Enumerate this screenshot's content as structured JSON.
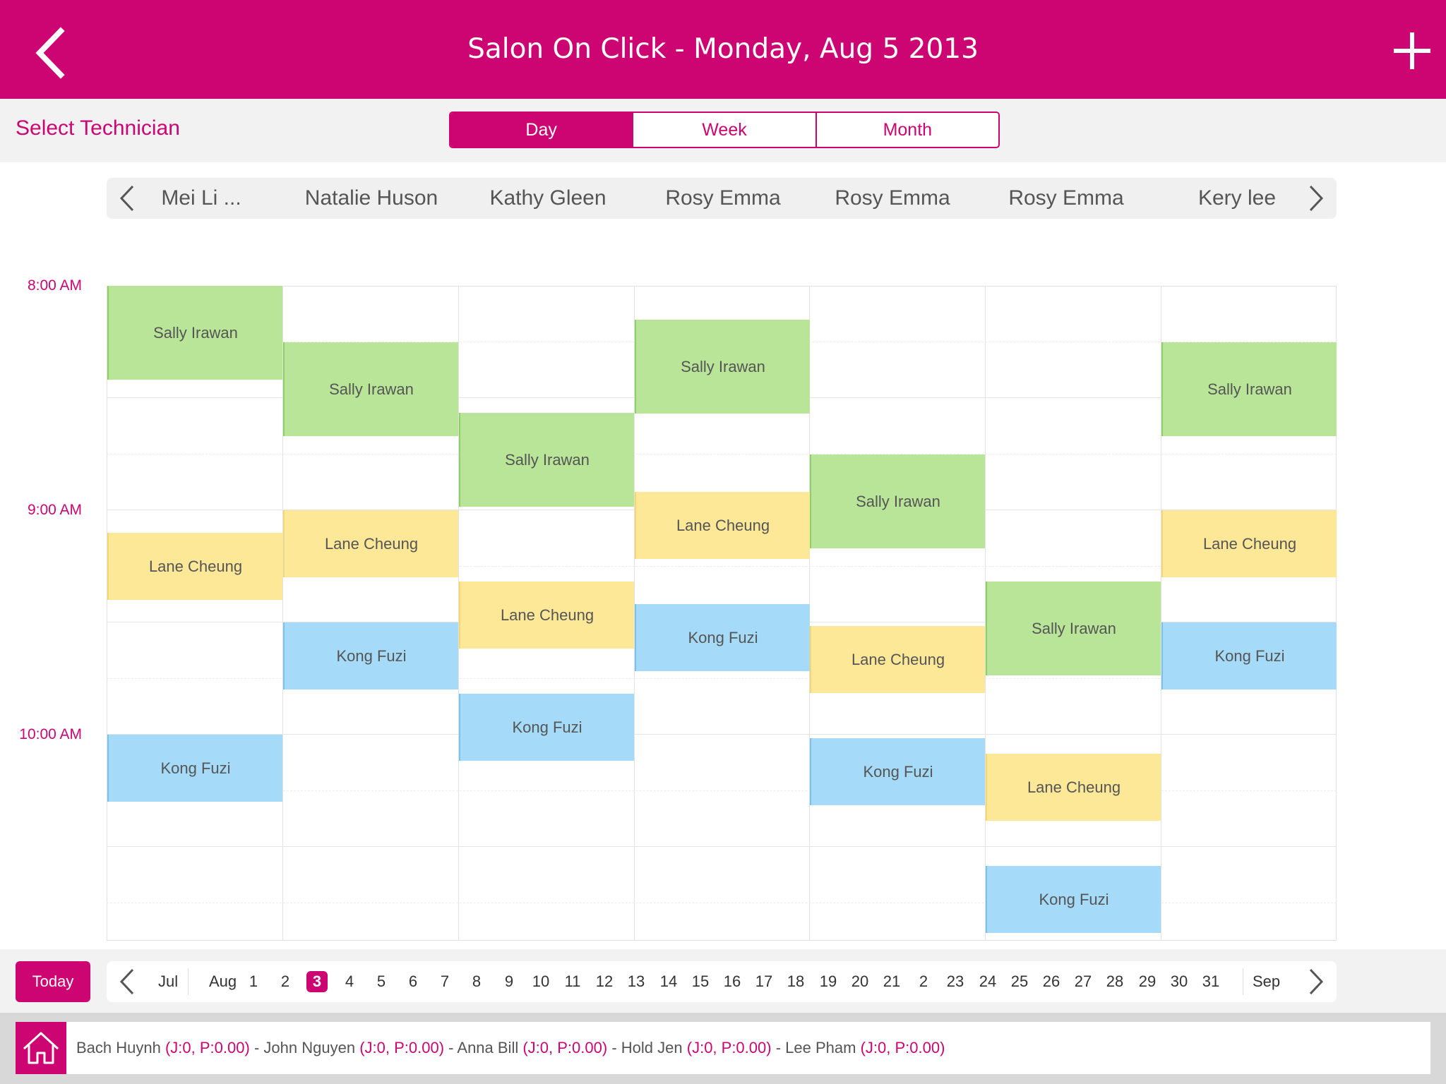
{
  "header": {
    "title": "Salon On Click - Monday, Aug 5 2013"
  },
  "toolbar": {
    "select_technician": "Select Technician"
  },
  "view_tabs": [
    {
      "label": "Day",
      "active": true
    },
    {
      "label": "Week",
      "active": false
    },
    {
      "label": "Month",
      "active": false
    }
  ],
  "technicians": [
    "Mei Li ...",
    "Natalie Huson",
    "Kathy Gleen",
    "Rosy Emma",
    "Rosy Emma",
    "Rosy Emma",
    "Kery lee"
  ],
  "time_labels": [
    "8:00 AM",
    "9:00 AM",
    "10:00 AM"
  ],
  "appointments": [
    {
      "column": 0,
      "client": "Sally Irawan",
      "start": "8:00",
      "end": "8:25",
      "color": "green"
    },
    {
      "column": 0,
      "client": "Lane Cheung",
      "start": "9:06",
      "end": "9:24",
      "color": "yellow"
    },
    {
      "column": 0,
      "client": "Kong Fuzi",
      "start": "10:00",
      "end": "10:18",
      "color": "blue"
    },
    {
      "column": 1,
      "client": "Sally Irawan",
      "start": "8:15",
      "end": "8:40",
      "color": "green"
    },
    {
      "column": 1,
      "client": "Lane Cheung",
      "start": "9:00",
      "end": "9:18",
      "color": "yellow"
    },
    {
      "column": 1,
      "client": "Kong Fuzi",
      "start": "9:30",
      "end": "9:48",
      "color": "blue"
    },
    {
      "column": 2,
      "client": "Sally Irawan",
      "start": "8:34",
      "end": "8:59",
      "color": "green"
    },
    {
      "column": 2,
      "client": "Lane Cheung",
      "start": "9:19",
      "end": "9:37",
      "color": "yellow"
    },
    {
      "column": 2,
      "client": "Kong Fuzi",
      "start": "9:49",
      "end": "10:07",
      "color": "blue"
    },
    {
      "column": 3,
      "client": "Sally Irawan",
      "start": "8:09",
      "end": "8:34",
      "color": "green"
    },
    {
      "column": 3,
      "client": "Lane Cheung",
      "start": "8:55",
      "end": "9:13",
      "color": "yellow"
    },
    {
      "column": 3,
      "client": "Kong Fuzi",
      "start": "9:25",
      "end": "9:43",
      "color": "blue"
    },
    {
      "column": 4,
      "client": "Sally Irawan",
      "start": "8:45",
      "end": "9:10",
      "color": "green"
    },
    {
      "column": 4,
      "client": "Lane Cheung",
      "start": "9:31",
      "end": "9:49",
      "color": "yellow"
    },
    {
      "column": 4,
      "client": "Kong Fuzi",
      "start": "10:01",
      "end": "10:19",
      "color": "blue"
    },
    {
      "column": 5,
      "client": "Sally Irawan",
      "start": "9:19",
      "end": "9:44",
      "color": "green"
    },
    {
      "column": 5,
      "client": "Lane Cheung",
      "start": "10:05",
      "end": "10:23",
      "color": "yellow"
    },
    {
      "column": 5,
      "client": "Kong Fuzi",
      "start": "10:35",
      "end": "10:53",
      "color": "blue"
    },
    {
      "column": 6,
      "client": "Sally Irawan",
      "start": "8:15",
      "end": "8:40",
      "color": "green"
    },
    {
      "column": 6,
      "client": "Lane Cheung",
      "start": "9:00",
      "end": "9:18",
      "color": "yellow"
    },
    {
      "column": 6,
      "client": "Kong Fuzi",
      "start": "9:30",
      "end": "9:48",
      "color": "blue"
    }
  ],
  "colors": {
    "brand": "#cc0572",
    "green": "#b9e598",
    "yellow": "#fde898",
    "blue": "#a5dbf8"
  },
  "date_bar": {
    "today_label": "Today",
    "prev_month": "Jul",
    "current_month": "Aug",
    "next_month": "Sep",
    "days": [
      "1",
      "2",
      "3",
      "4",
      "5",
      "6",
      "7",
      "8",
      "9",
      "10",
      "11",
      "12",
      "13",
      "14",
      "15",
      "16",
      "17",
      "18",
      "19",
      "20",
      "21",
      "2",
      "23",
      "24",
      "25",
      "26",
      "27",
      "28",
      "29",
      "30",
      "31"
    ],
    "selected_day": "3"
  },
  "status_bar": {
    "staff": [
      {
        "name": "Bach Huynh",
        "stats": "(J:0, P:0.00)"
      },
      {
        "name": "John Nguyen",
        "stats": "(J:0, P:0.00)"
      },
      {
        "name": "Anna Bill",
        "stats": "(J:0, P:0.00)"
      },
      {
        "name": "Hold Jen",
        "stats": "(J:0, P:0.00)"
      },
      {
        "name": "Lee Pham",
        "stats": "(J:0, P:0.00)"
      }
    ]
  }
}
